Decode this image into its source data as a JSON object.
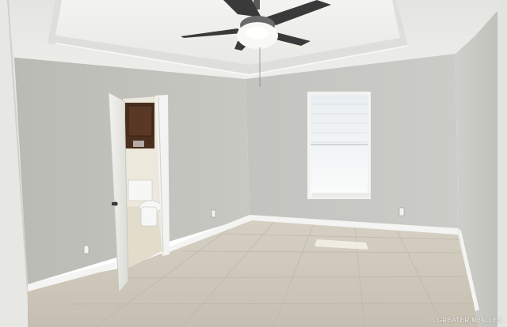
{
  "scene": {
    "description_tags": [
      "empty-room",
      "ceiling-fan",
      "tray-ceiling",
      "open-door",
      "bathroom",
      "window",
      "tile-floor"
    ],
    "colors": {
      "wall": "#c4c5c0",
      "ceiling": "#e9eae6",
      "floor": "#cfc8bb",
      "trim": "#f3f3f1",
      "cabinet": "#4a2e1e",
      "window_light": "#f4f6f7"
    }
  },
  "watermark": {
    "text": "GREATER McALLEN",
    "icon": "house-icon"
  }
}
